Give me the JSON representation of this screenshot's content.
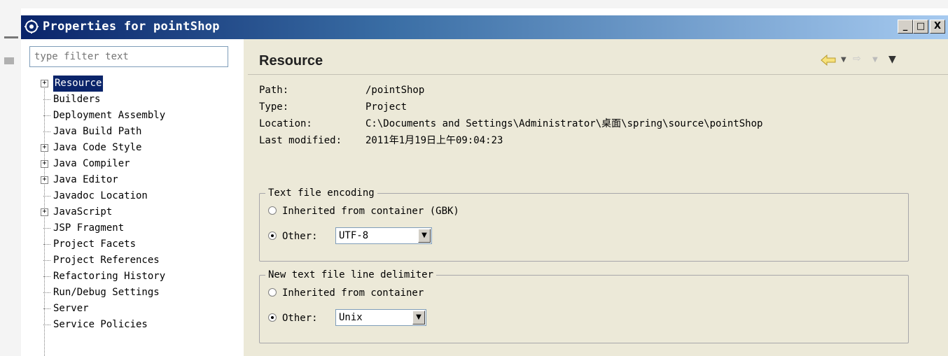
{
  "window": {
    "title": "Properties for pointShop",
    "buttons": {
      "minimize": "_",
      "maximize": "□",
      "close": "X"
    }
  },
  "filter": {
    "placeholder": "type filter text"
  },
  "tree": {
    "items": [
      {
        "label": "Resource",
        "expandable": true,
        "selected": true
      },
      {
        "label": "Builders",
        "expandable": false
      },
      {
        "label": "Deployment Assembly",
        "expandable": false
      },
      {
        "label": "Java Build Path",
        "expandable": false
      },
      {
        "label": "Java Code Style",
        "expandable": true
      },
      {
        "label": "Java Compiler",
        "expandable": true
      },
      {
        "label": "Java Editor",
        "expandable": true
      },
      {
        "label": "Javadoc Location",
        "expandable": false
      },
      {
        "label": "JavaScript",
        "expandable": true
      },
      {
        "label": "JSP Fragment",
        "expandable": false
      },
      {
        "label": "Project Facets",
        "expandable": false
      },
      {
        "label": "Project References",
        "expandable": false
      },
      {
        "label": "Refactoring History",
        "expandable": false
      },
      {
        "label": "Run/Debug Settings",
        "expandable": false
      },
      {
        "label": "Server",
        "expandable": false
      },
      {
        "label": "Service Policies",
        "expandable": false
      }
    ]
  },
  "page": {
    "title": "Resource",
    "info": {
      "path_label": "Path:",
      "path_value": "/pointShop",
      "type_label": "Type:",
      "type_value": "Project",
      "location_label": "Location:",
      "location_value": "C:\\Documents and Settings\\Administrator\\桌面\\spring\\source\\pointShop",
      "modified_label": "Last modified:",
      "modified_value": "2011年1月19日上午09:04:23"
    },
    "encoding": {
      "legend": "Text file encoding",
      "inherited_label": "Inherited from container (GBK)",
      "other_label": "Other:",
      "other_value": "UTF-8",
      "selected": "other"
    },
    "delimiter": {
      "legend": "New text file line delimiter",
      "inherited_label": "Inherited from container",
      "other_label": "Other:",
      "other_value": "Unix",
      "selected": "other"
    }
  },
  "colors": {
    "titlebar_start": "#0a246a",
    "titlebar_end": "#a6caf0",
    "selection": "#0a246a",
    "panel_bg": "#ece9d8"
  }
}
